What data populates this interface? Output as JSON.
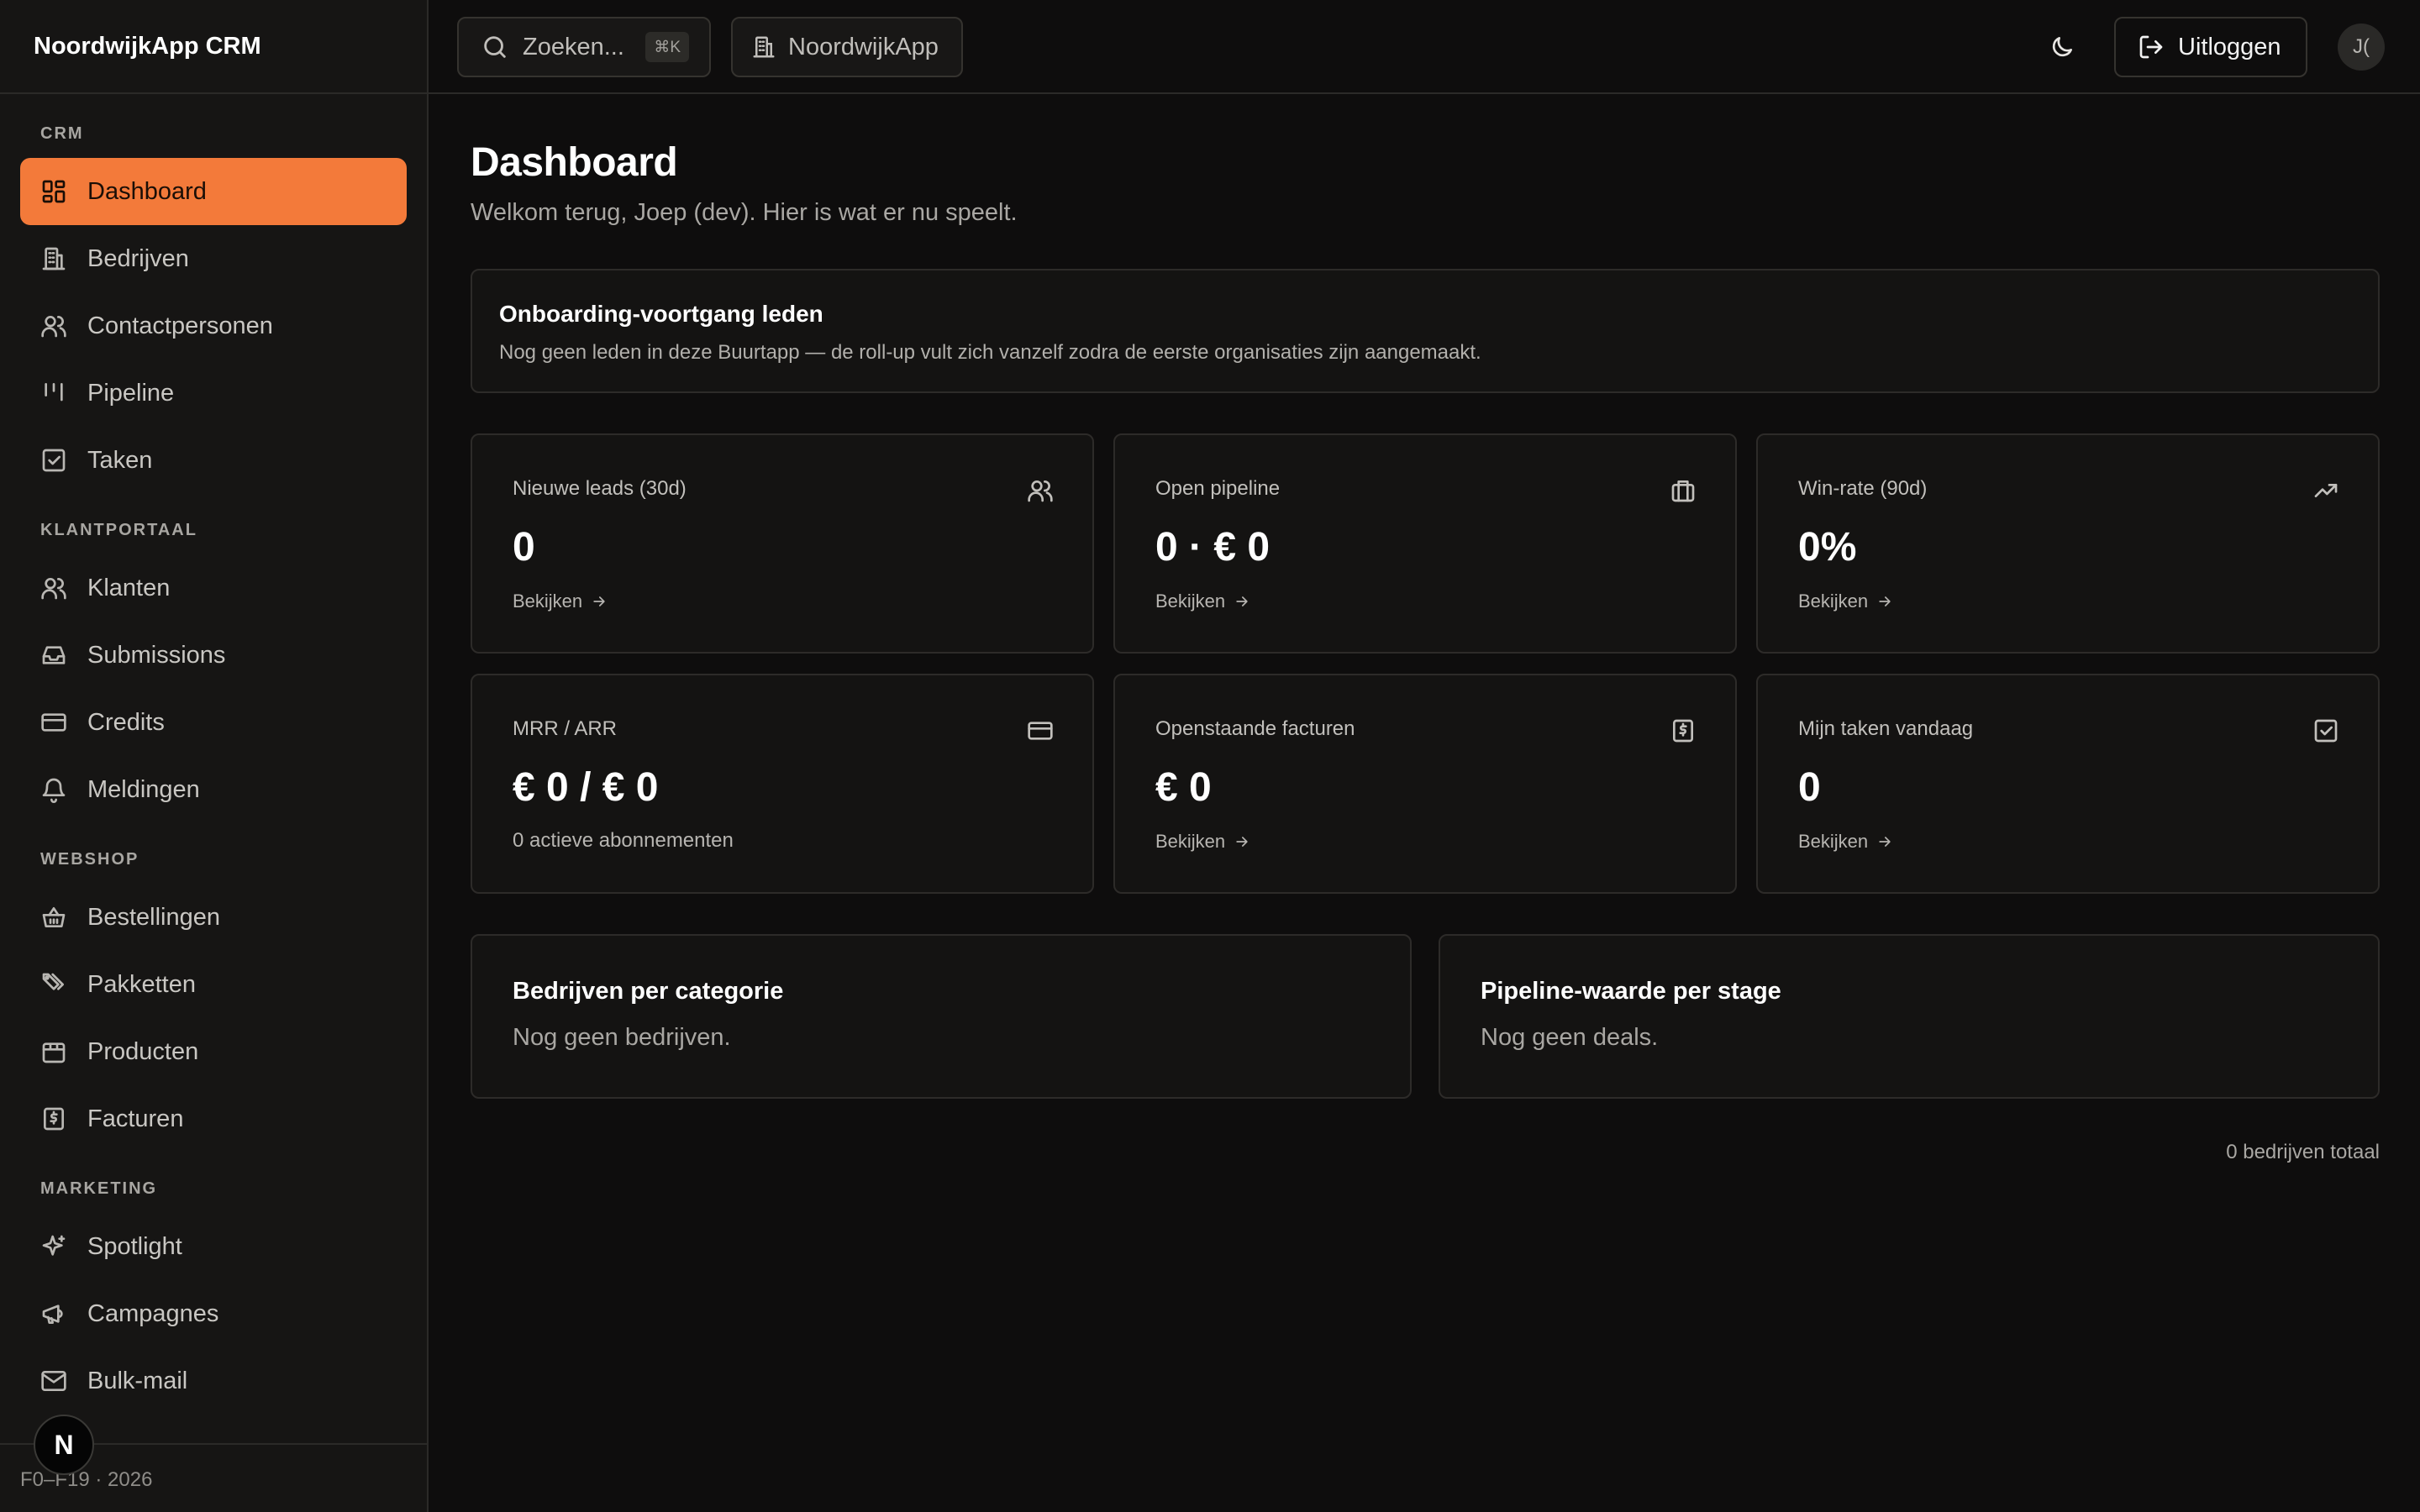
{
  "app": {
    "title": "NoordwijkApp CRM"
  },
  "sidebar": {
    "sections": [
      {
        "label": "CRM",
        "items": [
          {
            "label": "Dashboard",
            "icon": "dashboard-icon",
            "active": true
          },
          {
            "label": "Bedrijven",
            "icon": "building-icon"
          },
          {
            "label": "Contactpersonen",
            "icon": "users-icon"
          },
          {
            "label": "Pipeline",
            "icon": "pipeline-icon"
          },
          {
            "label": "Taken",
            "icon": "checkbox-icon"
          }
        ]
      },
      {
        "label": "KLANTPORTAAL",
        "items": [
          {
            "label": "Klanten",
            "icon": "users-icon"
          },
          {
            "label": "Submissions",
            "icon": "inbox-icon"
          },
          {
            "label": "Credits",
            "icon": "credit-card-icon"
          },
          {
            "label": "Meldingen",
            "icon": "bell-icon"
          }
        ]
      },
      {
        "label": "WEBSHOP",
        "items": [
          {
            "label": "Bestellingen",
            "icon": "basket-icon"
          },
          {
            "label": "Pakketten",
            "icon": "tags-icon"
          },
          {
            "label": "Producten",
            "icon": "package-icon"
          },
          {
            "label": "Facturen",
            "icon": "receipt-icon"
          }
        ]
      },
      {
        "label": "MARKETING",
        "items": [
          {
            "label": "Spotlight",
            "icon": "sparkles-icon"
          },
          {
            "label": "Campagnes",
            "icon": "megaphone-icon"
          },
          {
            "label": "Bulk-mail",
            "icon": "mail-icon"
          }
        ]
      }
    ],
    "footer_text": "F0–F19 · 2026",
    "badge_letter": "N"
  },
  "header": {
    "search_placeholder": "Zoeken...",
    "search_shortcut": "⌘K",
    "org_name": "NoordwijkApp",
    "logout_label": "Uitloggen",
    "avatar_initials": "J("
  },
  "main": {
    "title": "Dashboard",
    "subtitle": "Welkom terug, Joep (dev). Hier is wat er nu speelt.",
    "onboarding": {
      "title": "Onboarding-voortgang leden",
      "text": "Nog geen leden in deze Buurtapp — de roll-up vult zich vanzelf zodra de eerste organisaties zijn aangemaakt."
    },
    "stats": [
      {
        "label": "Nieuwe leads (30d)",
        "value": "0",
        "link": "Bekijken",
        "icon": "users-icon"
      },
      {
        "label": "Open pipeline",
        "value": "0 · € 0",
        "link": "Bekijken",
        "icon": "briefcase-icon"
      },
      {
        "label": "Win-rate (90d)",
        "value": "0%",
        "link": "Bekijken",
        "icon": "trending-up-icon"
      },
      {
        "label": "MRR / ARR",
        "value": "€ 0 / € 0",
        "sub": "0 actieve abonnementen",
        "icon": "credit-card-icon"
      },
      {
        "label": "Openstaande facturen",
        "value": "€ 0",
        "link": "Bekijken",
        "icon": "receipt-icon"
      },
      {
        "label": "Mijn taken vandaag",
        "value": "0",
        "link": "Bekijken",
        "icon": "checkbox-icon"
      }
    ],
    "panels": [
      {
        "title": "Bedrijven per categorie",
        "text": "Nog geen bedrijven."
      },
      {
        "title": "Pipeline-waarde per stage",
        "text": "Nog geen deals."
      }
    ],
    "total": "0 bedrijven totaal"
  }
}
